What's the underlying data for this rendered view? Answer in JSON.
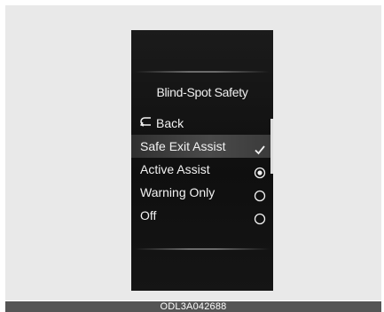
{
  "screen": {
    "title": "Blind-Spot Safety",
    "back_label": "Back",
    "items": [
      {
        "label": "Safe Exit Assist",
        "state": "checked",
        "icon": "checkmark-icon"
      },
      {
        "label": "Active Assist",
        "state": "radio-selected",
        "icon": "radio-selected-icon"
      },
      {
        "label": "Warning Only",
        "state": "radio-unselected",
        "icon": "radio-unselected-icon"
      },
      {
        "label": "Off",
        "state": "radio-unselected",
        "icon": "radio-unselected-icon"
      }
    ]
  },
  "caption": "ODL3A042688",
  "colors": {
    "background": "#e9e9e9",
    "screen": "#111111",
    "text": "#f2f2f2",
    "caption_bar": "#555555"
  }
}
